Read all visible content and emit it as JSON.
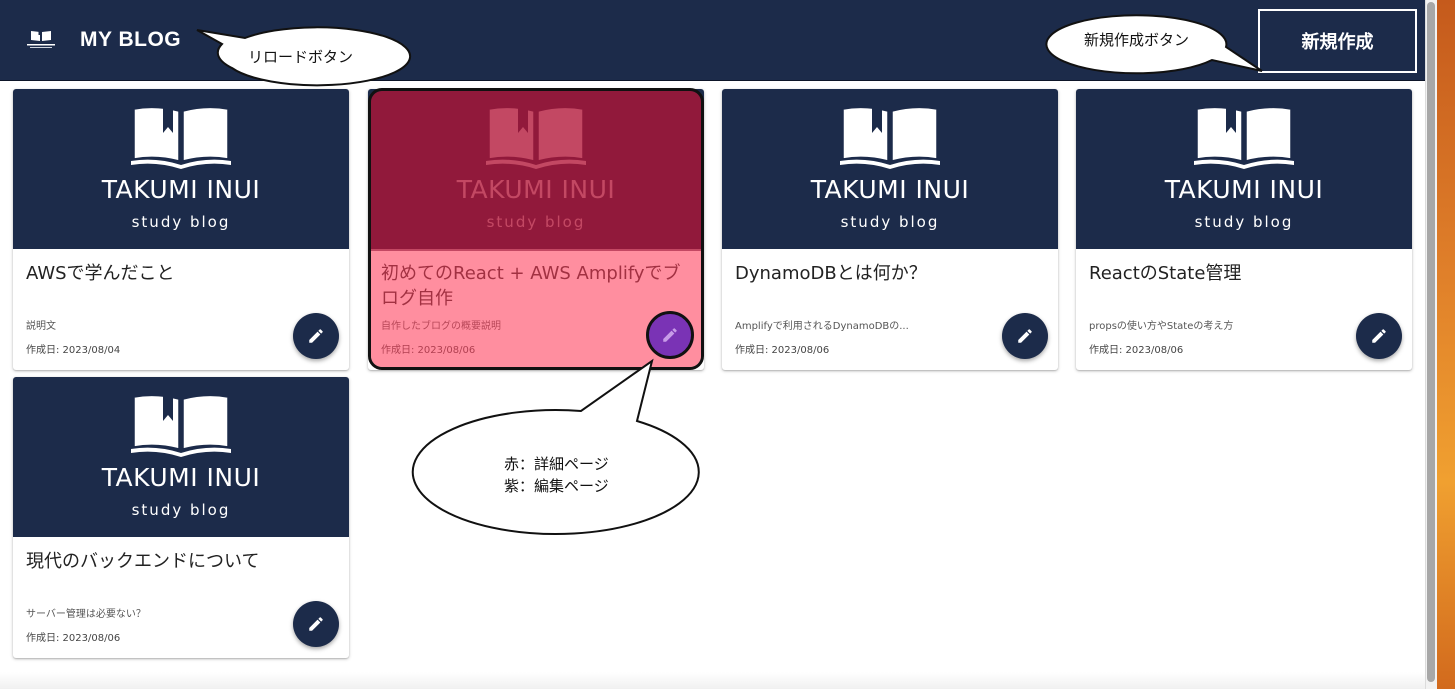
{
  "header": {
    "title": "MY BLOG",
    "new_button_label": "新規作成",
    "logo_text": "TAKUMI INUI study blog"
  },
  "card_brand": {
    "name": "TAKUMI INUI",
    "sub": "study blog"
  },
  "posts": [
    {
      "title": "AWSで学んだこと",
      "description": "説明文",
      "date": "作成日: 2023/08/04"
    },
    {
      "title": "初めてのReact + AWS Amplifyでブログ自作",
      "description": "自作したブログの概要説明",
      "date": "作成日: 2023/08/06"
    },
    {
      "title": "DynamoDBとは何か？",
      "description": "Amplifyで利用されるDynamoDBの...",
      "date": "作成日: 2023/08/06"
    },
    {
      "title": "ReactのState管理",
      "description": "propsの使い方やStateの考え方",
      "date": "作成日: 2023/08/06"
    },
    {
      "title": "現代のバックエンドについて",
      "description": "サーバー管理は必要ない？",
      "date": "作成日: 2023/08/06"
    }
  ],
  "annotations": {
    "reload_callout": "リロードボタン",
    "new_callout": "新規作成ボタン",
    "color_legend_line1": "赤：詳細ページ",
    "color_legend_line2": "紫：編集ページ"
  },
  "colors": {
    "navy": "#1c2b4a",
    "highlight_red": "#b21437",
    "highlight_purple": "#7a33b5"
  },
  "icons": {
    "logo": "open-book-icon",
    "edit": "pencil-icon"
  }
}
